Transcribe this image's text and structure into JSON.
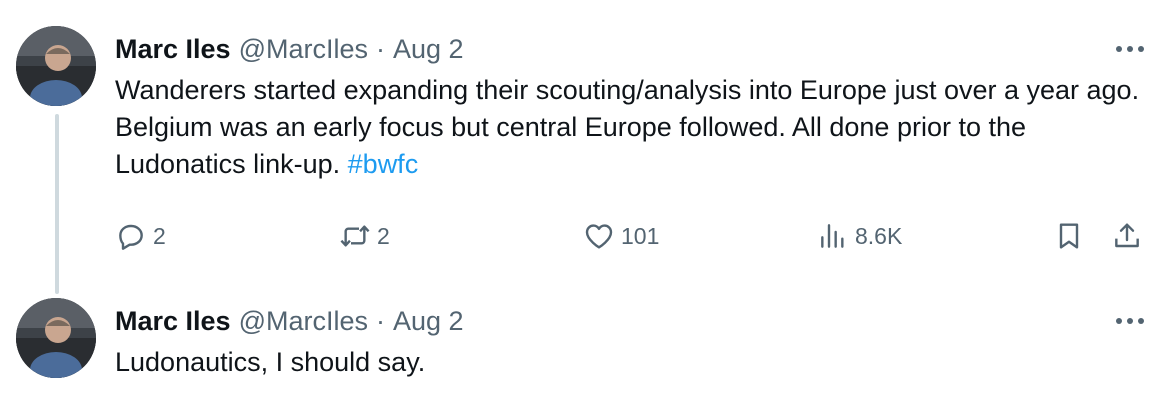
{
  "tweets": [
    {
      "author": "Marc Iles",
      "handle": "@MarcIles",
      "separator": "·",
      "date": "Aug 2",
      "text": "Wanderers started expanding their scouting/analysis into Europe just over a year ago. Belgium was an early focus but central Europe followed. All done prior to the Ludonatics link-up.",
      "hashtag": "#bwfc",
      "stats": {
        "replies": "2",
        "reposts": "2",
        "likes": "101",
        "views": "8.6K"
      }
    },
    {
      "author": "Marc Iles",
      "handle": "@MarcIles",
      "separator": "·",
      "date": "Aug 2",
      "text": "Ludonautics, I should say."
    }
  ],
  "icons": {
    "reply": "speech-bubble-icon",
    "repost": "repost-arrows-icon",
    "like": "heart-icon",
    "views": "bar-chart-icon",
    "bookmark": "bookmark-icon",
    "share": "share-upload-icon",
    "more": "ellipsis-icon"
  },
  "colors": {
    "text": "#0f1419",
    "secondary": "#536471",
    "link": "#1d9bf0",
    "thread": "#cfd9de"
  }
}
